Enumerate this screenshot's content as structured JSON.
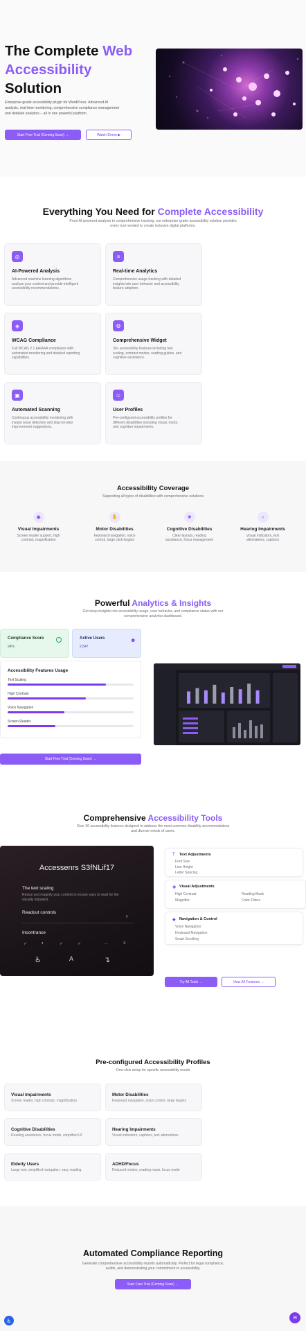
{
  "hero": {
    "title_line1": "The Complete ",
    "title_accent1": "Web",
    "title_line2": "Accessibility",
    "title_line3": "Solution",
    "desc_line1": "Enterprise-grade accessibility plugin for WordPress. Advanced AI",
    "desc_line2": "analysis, real-time monitoring, comprehensive compliance management",
    "desc_line3": "and detailed analytics – all in one powerful platform.",
    "cta_primary": "Start Free Trial (Coming Soon) →",
    "cta_secondary": "Watch Demo ▶"
  },
  "features": {
    "title": "Everything You Need for ",
    "title_accent": "Complete Accessibility",
    "subtitle_line1": "From AI-powered analysis to comprehensive tracking, our enterprise-grade accessibility solution provides",
    "subtitle_line2": "every tool needed to create inclusive digital platforms.",
    "cards": [
      {
        "icon": "target-icon",
        "glyph": "◎",
        "title": "AI-Powered Analysis",
        "desc1": "Advanced machine learning algorithms",
        "desc2": "analyze your content and provide intelligent",
        "desc3": "accessibility recommendations."
      },
      {
        "icon": "analytics-icon",
        "glyph": "≡",
        "title": "Real-time Analytics",
        "desc1": "Comprehensive usage tracking with detailed",
        "desc2": "insights into user behavior and accessibility",
        "desc3": "feature adoption."
      },
      {
        "icon": "shield-icon",
        "glyph": "◈",
        "title": "WCAG Compliance",
        "desc1": "Full WCAG 2.1 AA/AAA compliance with",
        "desc2": "automated monitoring and detailed reporting",
        "desc3": "capabilities."
      },
      {
        "icon": "widget-icon",
        "glyph": "⚙",
        "title": "Comprehensive Widget",
        "desc1": "30+ accessibility features including text",
        "desc2": "scaling, contrast modes, reading guides, and",
        "desc3": "cognitive assistance."
      },
      {
        "icon": "scan-icon",
        "glyph": "▣",
        "title": "Automated Scanning",
        "desc1": "Continuous accessibility monitoring with",
        "desc2": "instant issue detection and step-by-step",
        "desc3": "improvement suggestions."
      },
      {
        "icon": "user-icon",
        "glyph": "☺",
        "title": "User Profiles",
        "desc1": "Pre-configured accessibility profiles for",
        "desc2": "different disabilities including visual, motor,",
        "desc3": "and cognitive impairments."
      }
    ]
  },
  "coverage": {
    "title": "Accessibility Coverage",
    "subtitle": "Supporting all types of disabilities with comprehensive solutions",
    "items": [
      {
        "icon": "eye-icon",
        "glyph": "◉",
        "title": "Visual Impairments",
        "desc1": "Screen reader support, high",
        "desc2": "contrast, magnification"
      },
      {
        "icon": "hand-icon",
        "glyph": "✋",
        "title": "Motor Disabilities",
        "desc1": "Keyboard navigation, voice",
        "desc2": "control, large click targets"
      },
      {
        "icon": "brain-icon",
        "glyph": "❀",
        "title": "Cognitive Disabilities",
        "desc1": "Clear layouts, reading",
        "desc2": "assistance, focus management"
      },
      {
        "icon": "headphones-icon",
        "glyph": "∩",
        "title": "Hearing Impairments",
        "desc1": "Visual indicators, text",
        "desc2": "alternatives, captions"
      }
    ]
  },
  "analytics": {
    "title": "Powerful ",
    "title_accent": "Analytics & Insights",
    "subtitle_line1": "Get deep insights into accessibility usage, user behavior, and compliance status with our",
    "subtitle_line2": "comprehensive analytics dashboard.",
    "stat1_label": "Compliance Score",
    "stat1_value": "94%",
    "stat2_label": "Active Users",
    "stat2_value": "2,847",
    "usage_title": "Accessibility Features Usage",
    "usage": [
      {
        "label": "Text Scaling",
        "value": 0.78
      },
      {
        "label": "High Contrast",
        "value": 0.62
      },
      {
        "label": "Voice Navigation",
        "value": 0.45
      },
      {
        "label": "Screen Reader",
        "value": 0.38
      }
    ],
    "cta": "Start Free Trial (Coming Soon) →",
    "dash_bars": [
      0.55,
      0.7,
      0.6,
      0.85,
      0.5,
      0.75,
      0.65,
      0.9,
      0.6
    ]
  },
  "tools": {
    "title": "Comprehensive ",
    "title_accent": "Accessibility Tools",
    "subtitle_line1": "Over 30 accessibility features designed to address the most common disability accommodations",
    "subtitle_line2": "and diverse needs of users.",
    "widget_title": "Accessenrs S3fNLif17",
    "widget_section1": "The text scaling",
    "widget_section1_desc1": "Resize and magnify your content to ensure easy to read for the",
    "widget_section1_desc2": "visually impaired.",
    "widget_row1": "Readout controls",
    "widget_row2": "Incontrance",
    "text_adj_title": "Text Adjustments",
    "text_adj_items": [
      "Font Size",
      "Line Height",
      "Letter Spacing"
    ],
    "visual_title": "Visual Adjustments",
    "visual_items_left": [
      "High Contrast",
      "Magnifier"
    ],
    "visual_items_right": [
      "Reading Mask",
      "Color Filters"
    ],
    "nav_title": "Navigation & Control",
    "nav_items": [
      "Voice Navigation",
      "Keyboard Navigation",
      "Smart Scrolling"
    ],
    "cta_primary": "Try All Tools →",
    "cta_secondary": "View All Features →"
  },
  "profiles": {
    "title": "Pre-configured Accessibility Profiles",
    "subtitle": "One-click setup for specific accessibility needs",
    "items": [
      {
        "title": "Visual Impairments",
        "desc": "Screen reader, high contrast, magnification"
      },
      {
        "title": "Motor Disabilities",
        "desc": "Keyboard navigation, voice control, large targets"
      },
      {
        "title": "Cognitive Disabilities",
        "desc": "Reading assistance, focus mode, simplified UI"
      },
      {
        "title": "Hearing Impairments",
        "desc": "Visual indicators, captions, text alternatives"
      },
      {
        "title": "Elderly Users",
        "desc": "Large text, simplified navigation, easy reading"
      },
      {
        "title": "ADHD/Focus",
        "desc": "Reduced motion, reading mask, focus mode"
      }
    ]
  },
  "compliance": {
    "title": "Automated Compliance Reporting",
    "subtitle_line1": "Generate comprehensive accessibility reports automatically. Perfect for legal compliance,",
    "subtitle_line2": "audits, and demonstrating your commitment to accessibility.",
    "cta": "Start Free Trial (Coming Soon) →"
  },
  "colors": {
    "accent": "#8b5cf6",
    "accent_dark": "#7c3aed"
  }
}
